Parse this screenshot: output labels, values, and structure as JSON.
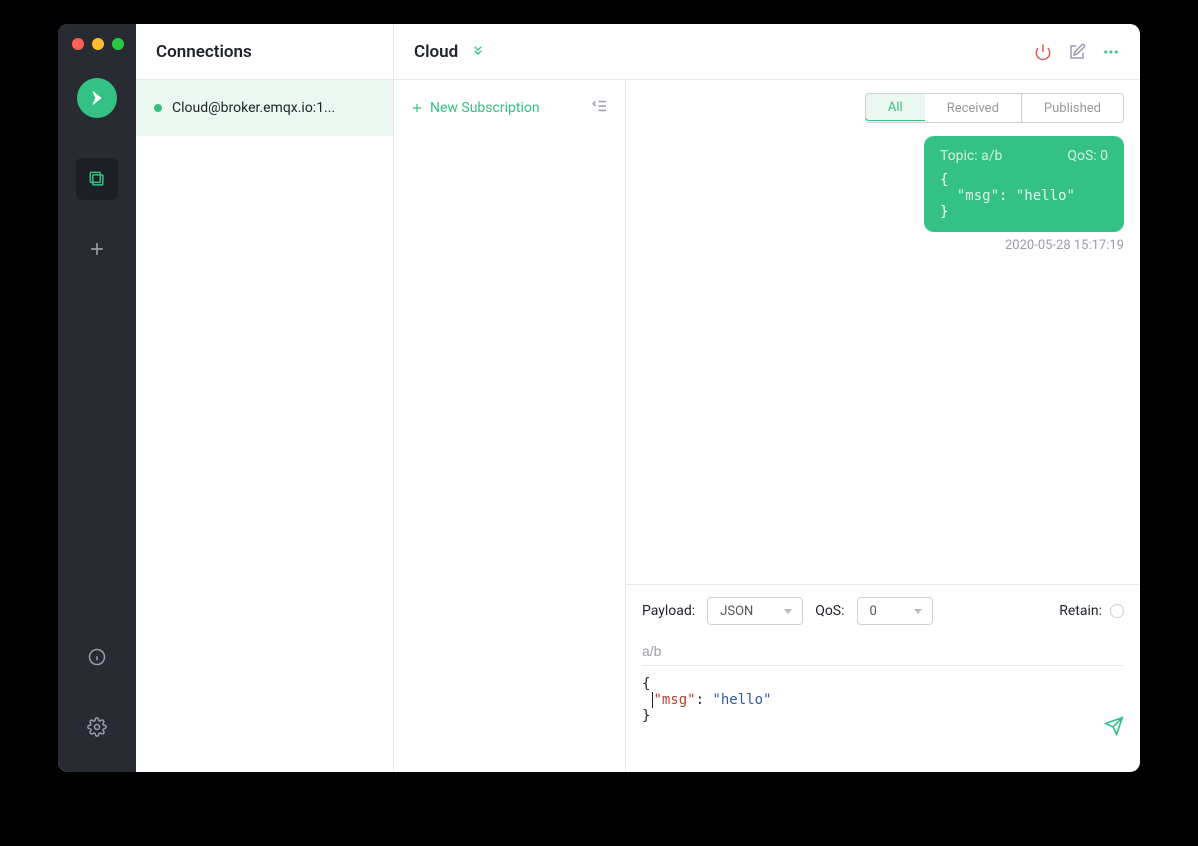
{
  "sidebar": {
    "title": "Connections",
    "items": [
      {
        "label": "Cloud@broker.emqx.io:1...",
        "status": "online"
      }
    ]
  },
  "header": {
    "title": "Cloud"
  },
  "subscriptions": {
    "new_label": "New Subscription"
  },
  "filters": {
    "all": "All",
    "received": "Received",
    "published": "Published"
  },
  "messages": [
    {
      "topic_label": "Topic: a/b",
      "qos_label": "QoS: 0",
      "body_line1": "{",
      "body_key": "\"msg\"",
      "body_colon": ": ",
      "body_val": "\"hello\"",
      "body_line3": "}",
      "timestamp": "2020-05-28 15:17:19"
    }
  ],
  "composer": {
    "payload_label": "Payload:",
    "payload_format": "JSON",
    "qos_label": "QoS:",
    "qos_value": "0",
    "retain_label": "Retain:",
    "topic": "a/b",
    "body_line1": "{",
    "body_key": "\"msg\"",
    "body_colon": ": ",
    "body_val": "\"hello\"",
    "body_line3": "}"
  }
}
